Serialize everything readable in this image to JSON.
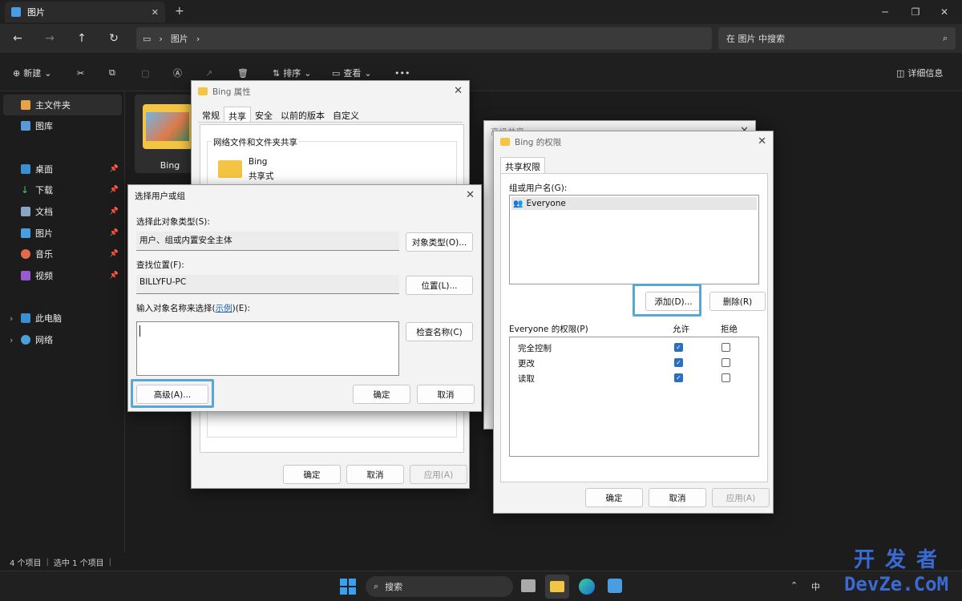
{
  "explorer": {
    "tab_title": "图片",
    "breadcrumb": "图片",
    "search_placeholder": "在 图片 中搜索",
    "toolbar": {
      "new_label": "新建",
      "sort_label": "排序",
      "view_label": "查看",
      "more": "•••",
      "details_label": "详细信息"
    },
    "sidebar": {
      "home": "主文件夹",
      "gallery": "图库",
      "pinned": [
        "桌面",
        "下载",
        "文档",
        "图片",
        "音乐",
        "视频"
      ],
      "thispc": "此电脑",
      "network": "网络"
    },
    "folder_name": "Bing",
    "status_count": "4 个项目",
    "status_selected": "选中 1 个项目"
  },
  "bing_props": {
    "title": "Bing 属性",
    "tabs": [
      "常规",
      "共享",
      "安全",
      "以前的版本",
      "自定义"
    ],
    "group_title": "网络文件和文件夹共享",
    "share_name": "Bing",
    "share_state": "共享式",
    "ok": "确定",
    "cancel": "取消",
    "apply": "应用(A)"
  },
  "adv_share": {
    "title": "高级共享"
  },
  "permissions": {
    "title": "Bing 的权限",
    "tab": "共享权限",
    "group_label": "组或用户名(G):",
    "users": [
      "Everyone"
    ],
    "add": "添加(D)...",
    "remove": "删除(R)",
    "perm_label": "Everyone 的权限(P)",
    "allow": "允许",
    "deny": "拒绝",
    "rows": [
      {
        "name": "完全控制",
        "allow": true,
        "deny": false
      },
      {
        "name": "更改",
        "allow": true,
        "deny": false
      },
      {
        "name": "读取",
        "allow": true,
        "deny": false
      }
    ],
    "ok": "确定",
    "cancel": "取消",
    "apply": "应用(A)"
  },
  "select_user": {
    "title": "选择用户或组",
    "obj_type_label": "选择此对象类型(S):",
    "obj_type_value": "用户、组或内置安全主体",
    "obj_type_btn": "对象类型(O)...",
    "location_label": "查找位置(F):",
    "location_value": "BILLYFU-PC",
    "location_btn": "位置(L)...",
    "enter_label_prefix": "输入对象名称来选择(",
    "enter_label_link": "示例",
    "enter_label_suffix": ")(E):",
    "check_btn": "检查名称(C)",
    "advanced_btn": "高级(A)...",
    "ok": "确定",
    "cancel": "取消"
  },
  "taskbar": {
    "search_label": "搜索",
    "ime": "中"
  },
  "watermark": {
    "line1": "开 发 者",
    "line2": "DevZe.CoM"
  },
  "colors": {
    "highlight": "#5ba7d3",
    "folder": "#f4c542",
    "check": "#2c6fbd"
  }
}
